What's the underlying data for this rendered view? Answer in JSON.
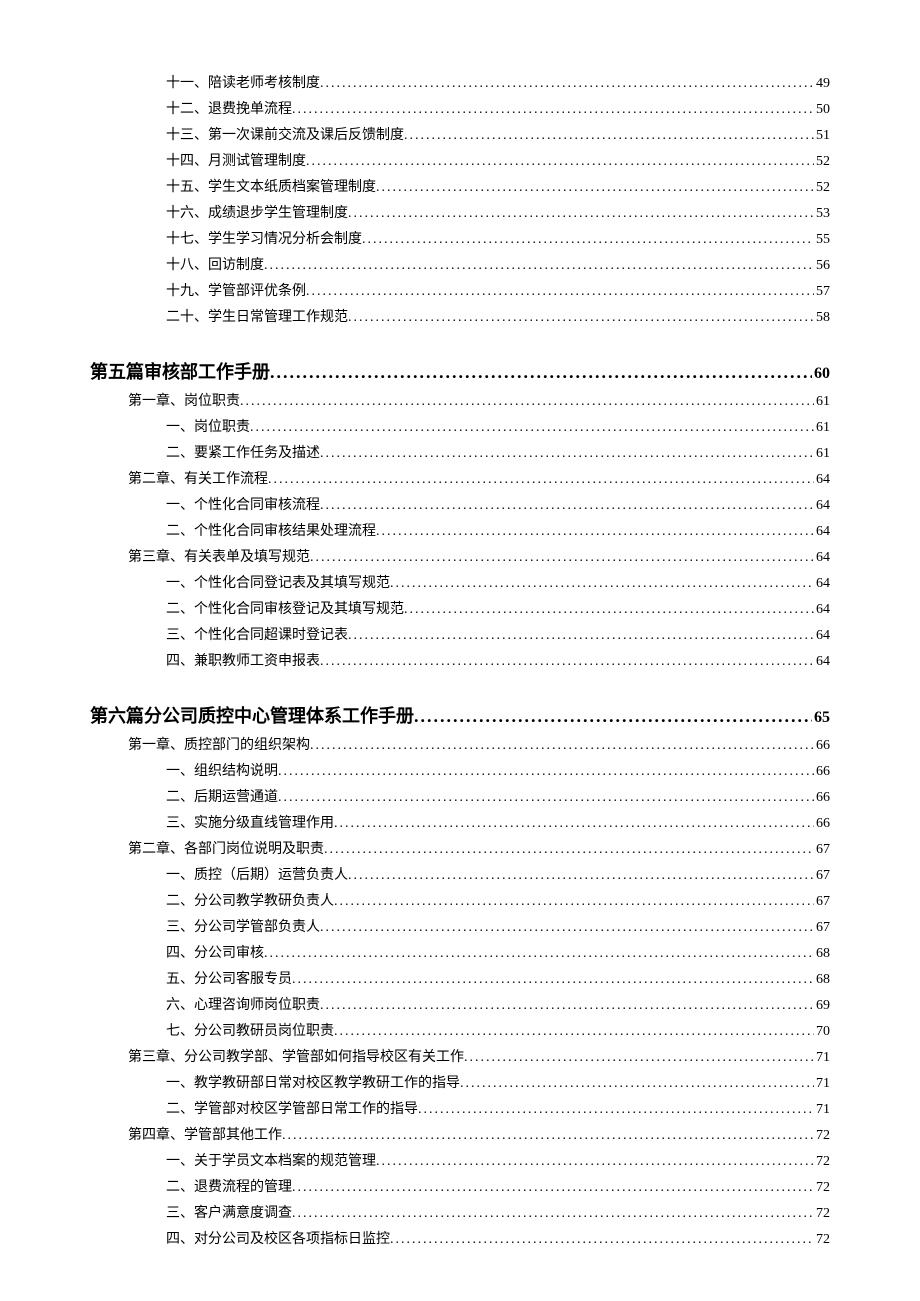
{
  "toc": [
    {
      "level": "section",
      "label": "十一、陪读老师考核制度",
      "page": "49"
    },
    {
      "level": "section",
      "label": "十二、退费挽单流程",
      "page": "50"
    },
    {
      "level": "section",
      "label": "十三、第一次课前交流及课后反馈制度",
      "page": "51"
    },
    {
      "level": "section",
      "label": "十四、月测试管理制度",
      "page": "52"
    },
    {
      "level": "section",
      "label": "十五、学生文本纸质档案管理制度",
      "page": "52"
    },
    {
      "level": "section",
      "label": "十六、成绩退步学生管理制度",
      "page": "53"
    },
    {
      "level": "section",
      "label": "十七、学生学习情况分析会制度",
      "page": "55"
    },
    {
      "level": "section",
      "label": "十八、回访制度",
      "page": "56"
    },
    {
      "level": "section",
      "label": "十九、学管部评优条例",
      "page": "57"
    },
    {
      "level": "section",
      "label": "二十、学生日常管理工作规范",
      "page": "58"
    },
    {
      "level": "part",
      "label": "第五篇审核部工作手册",
      "page": "60"
    },
    {
      "level": "chapter",
      "label": "第一章、岗位职责",
      "page": "61"
    },
    {
      "level": "section",
      "label": "一、岗位职责",
      "page": "61"
    },
    {
      "level": "section",
      "label": "二、要紧工作任务及描述",
      "page": "61"
    },
    {
      "level": "chapter",
      "label": "第二章、有关工作流程",
      "page": "64"
    },
    {
      "level": "section",
      "label": "一、个性化合同审核流程",
      "page": "64"
    },
    {
      "level": "section",
      "label": "二、个性化合同审核结果处理流程",
      "page": "64"
    },
    {
      "level": "chapter",
      "label": "第三章、有关表单及填写规范",
      "page": "64"
    },
    {
      "level": "section",
      "label": "一、个性化合同登记表及其填写规范",
      "page": "64"
    },
    {
      "level": "section",
      "label": "二、个性化合同审核登记及其填写规范",
      "page": "64"
    },
    {
      "level": "section",
      "label": "三、个性化合同超课时登记表",
      "page": "64"
    },
    {
      "level": "section",
      "label": "四、兼职教师工资申报表",
      "page": "64"
    },
    {
      "level": "part",
      "label": "第六篇分公司质控中心管理体系工作手册",
      "page": "65"
    },
    {
      "level": "chapter",
      "label": "第一章、质控部门的组织架构",
      "page": "66"
    },
    {
      "level": "section",
      "label": "一、组织结构说明",
      "page": "66"
    },
    {
      "level": "section",
      "label": "二、后期运营通道",
      "page": "66"
    },
    {
      "level": "section",
      "label": "三、实施分级直线管理作用",
      "page": "66"
    },
    {
      "level": "chapter",
      "label": "第二章、各部门岗位说明及职责",
      "page": "67"
    },
    {
      "level": "section",
      "label": "一、质控（后期）运营负责人",
      "page": "67"
    },
    {
      "level": "section",
      "label": "二、分公司教学教研负责人",
      "page": "67"
    },
    {
      "level": "section",
      "label": "三、分公司学管部负责人",
      "page": "67"
    },
    {
      "level": "section",
      "label": "四、分公司审核",
      "page": "68"
    },
    {
      "level": "section",
      "label": "五、分公司客服专员",
      "page": "68"
    },
    {
      "level": "section",
      "label": "六、心理咨询师岗位职责",
      "page": "69"
    },
    {
      "level": "section",
      "label": "七、分公司教研员岗位职责",
      "page": "70"
    },
    {
      "level": "chapter",
      "label": "第三章、分公司教学部、学管部如何指导校区有关工作",
      "page": "71"
    },
    {
      "level": "section",
      "label": "一、教学教研部日常对校区教学教研工作的指导",
      "page": "71"
    },
    {
      "level": "section",
      "label": "二、学管部对校区学管部日常工作的指导",
      "page": "71"
    },
    {
      "level": "chapter",
      "label": "第四章、学管部其他工作",
      "page": "72"
    },
    {
      "level": "section",
      "label": "一、关于学员文本档案的规范管理",
      "page": "72"
    },
    {
      "level": "section",
      "label": "二、退费流程的管理",
      "page": "72"
    },
    {
      "level": "section",
      "label": "三、客户满意度调查",
      "page": "72"
    },
    {
      "level": "section",
      "label": "四、对分公司及校区各项指标日监控",
      "page": "72"
    }
  ]
}
